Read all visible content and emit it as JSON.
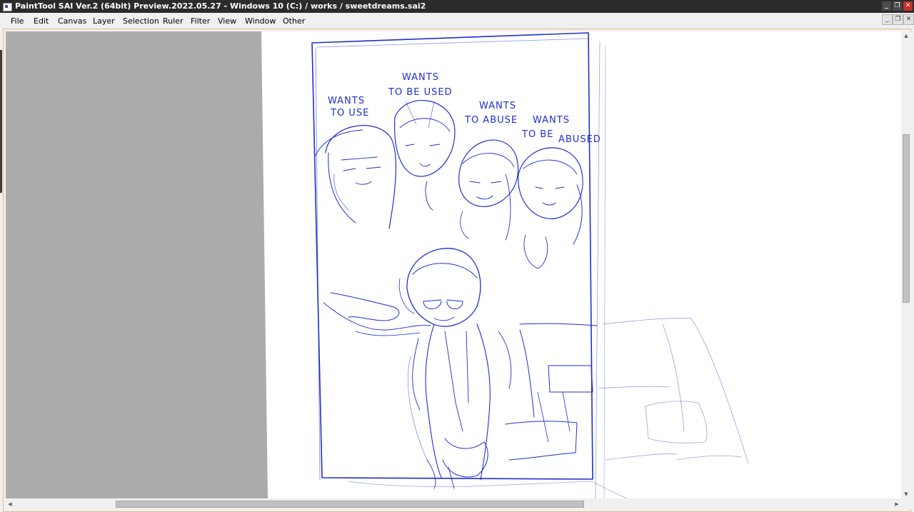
{
  "window": {
    "title": "PaintTool SAI Ver.2 (64bit) Preview.2022.05.27 - Windows 10 (C:) / works / sweetdreams.sai2",
    "controls": {
      "minimize": "_",
      "restore": "❐",
      "close": "✕"
    }
  },
  "menu": {
    "items": [
      "File",
      "Edit",
      "Canvas",
      "Layer",
      "Selection",
      "Ruler",
      "Filter",
      "View",
      "Window",
      "Other"
    ]
  },
  "document_controls": {
    "minimize": "_",
    "restore": "❐",
    "close": "✕"
  },
  "sketch": {
    "stroke_color": "#1f2fd0",
    "captions": [
      "WANTS",
      "TO USE",
      "WANTS",
      "TO BE USED",
      "WANTS",
      "TO ABUSE",
      "WANTS",
      "TO BE",
      "ABUSED"
    ]
  },
  "scrollbars": {
    "vertical": {
      "up": "▲",
      "down": "▼"
    },
    "horizontal": {
      "left": "◀",
      "right": "▶"
    }
  },
  "colors": {
    "titlebar": "#2b2b2b",
    "menubar": "#f0f0f0",
    "workspace": "#ababab",
    "paper": "#ffffff",
    "ink": "#1f2fd0",
    "frame_accent": "#e6b98f"
  }
}
